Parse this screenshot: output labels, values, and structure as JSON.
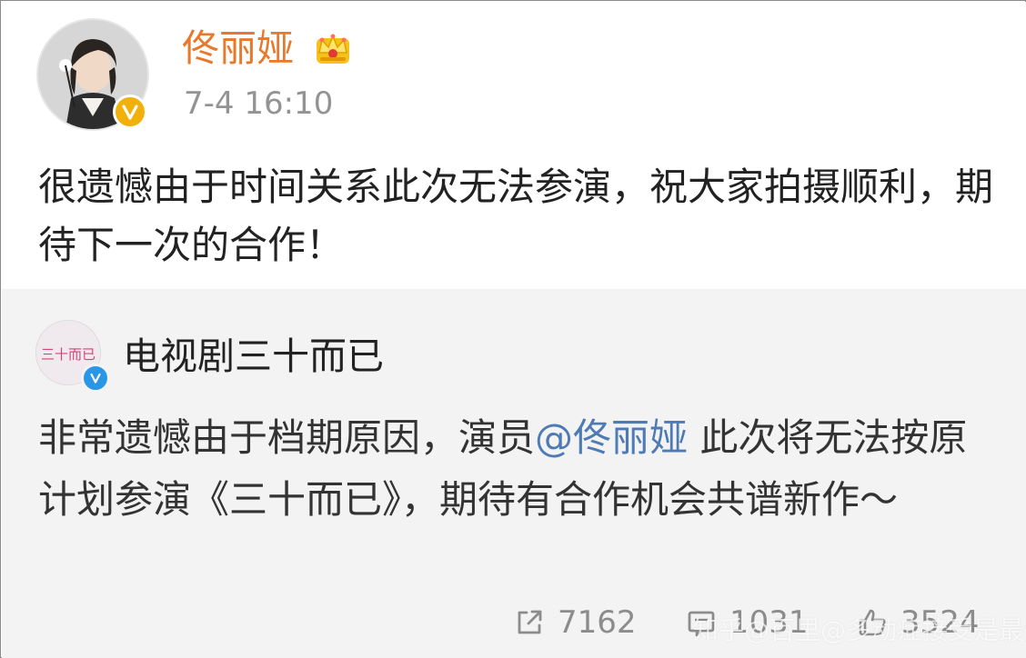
{
  "post": {
    "username": "佟丽娅",
    "timestamp": "7-4 16:10",
    "text": "很遗憾由于时间关系此次无法参演，祝大家拍摄顺利，期待下一次的合作！"
  },
  "repost": {
    "username": "电视剧三十而已",
    "avatar_text": "三十而已",
    "text_before": "非常遗憾由于档期原因，演员",
    "mention": "@佟丽娅",
    "text_after": " 此次将无法按原计划参演《三十而已》，期待有合作机会共谱新作～",
    "actions": {
      "repost_count": "7162",
      "comment_count": "1031",
      "like_count": "3524"
    }
  },
  "watermark": "知乎@百里@多动症接受是最爱",
  "colors": {
    "username": "#e8782c",
    "mention": "#4e7bb4",
    "repost_bg": "#f3f3f3",
    "vip_badge": "#f2b10a",
    "verified_badge": "#2a97e6"
  },
  "icons": {
    "crown": "crown-icon",
    "verified_v": "v-badge-icon",
    "repost": "repost-icon",
    "comment": "comment-icon",
    "like": "thumbs-up-icon"
  }
}
